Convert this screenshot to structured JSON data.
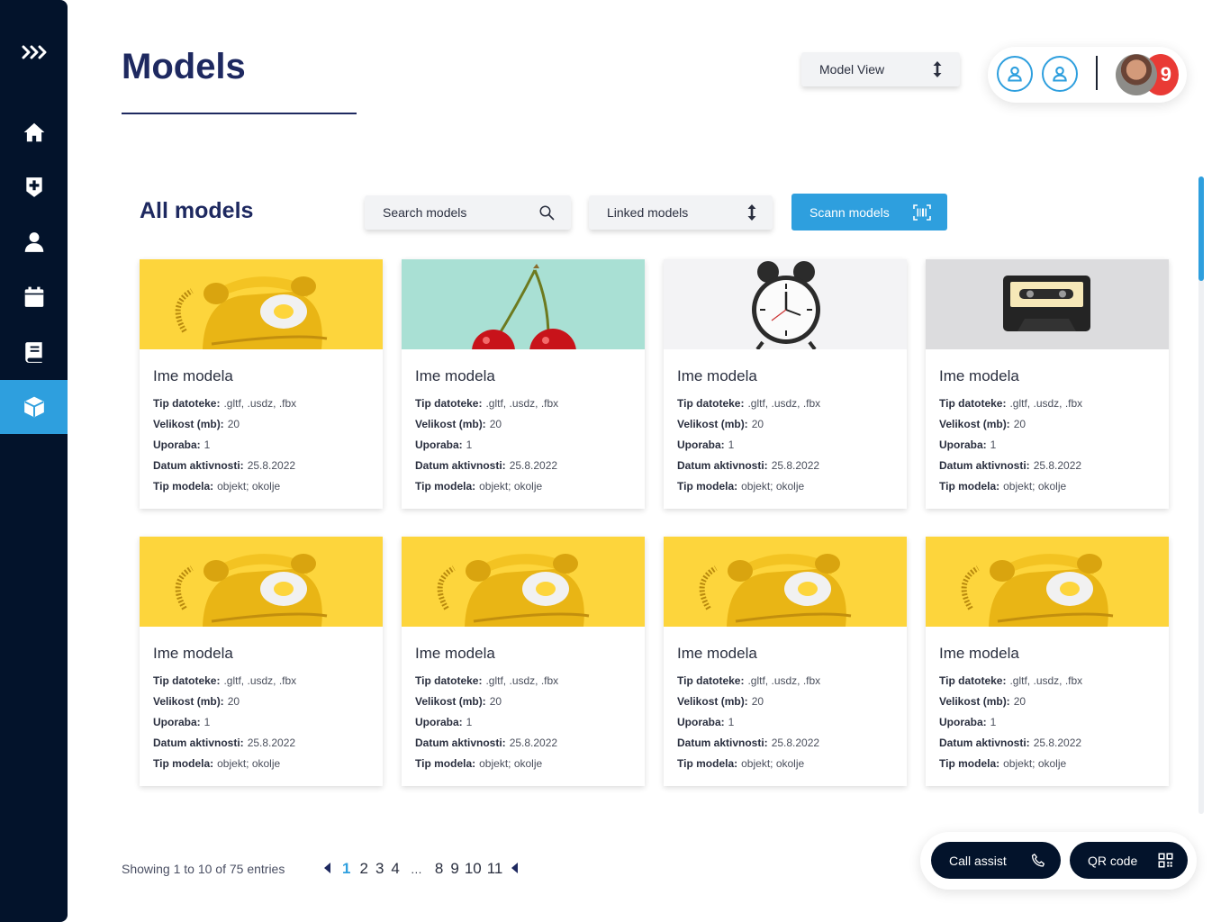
{
  "header": {
    "title": "Models",
    "view_select": "Model View"
  },
  "user": {
    "notification_count": "9"
  },
  "toolbar": {
    "section_title": "All models",
    "search_placeholder": "Search models",
    "filter_label": "Linked models",
    "scan_label": "Scann models"
  },
  "labels": {
    "file_type": "Tip datoteke:",
    "size": "Velikost (mb):",
    "usage": "Uporaba:",
    "activity_date": "Datum aktivnosti:",
    "model_type": "Tip modela:"
  },
  "cards": [
    {
      "image": "yellow-telephone",
      "name": "Ime modela",
      "file_type": ".gltf, .usdz, .fbx",
      "size": "20",
      "usage": "1",
      "activity_date": "25.8.2022",
      "model_type": "objekt; okolje"
    },
    {
      "image": "cherries",
      "name": "Ime modela",
      "file_type": ".gltf, .usdz, .fbx",
      "size": "20",
      "usage": "1",
      "activity_date": "25.8.2022",
      "model_type": "objekt; okolje"
    },
    {
      "image": "alarm-clock",
      "name": "Ime modela",
      "file_type": ".gltf, .usdz, .fbx",
      "size": "20",
      "usage": "1",
      "activity_date": "25.8.2022",
      "model_type": "objekt; okolje"
    },
    {
      "image": "cassette-tape",
      "name": "Ime modela",
      "file_type": ".gltf, .usdz, .fbx",
      "size": "20",
      "usage": "1",
      "activity_date": "25.8.2022",
      "model_type": "objekt; okolje"
    },
    {
      "image": "yellow-telephone",
      "name": "Ime modela",
      "file_type": ".gltf, .usdz, .fbx",
      "size": "20",
      "usage": "1",
      "activity_date": "25.8.2022",
      "model_type": "objekt; okolje"
    },
    {
      "image": "yellow-telephone",
      "name": "Ime modela",
      "file_type": ".gltf, .usdz, .fbx",
      "size": "20",
      "usage": "1",
      "activity_date": "25.8.2022",
      "model_type": "objekt; okolje"
    },
    {
      "image": "yellow-telephone",
      "name": "Ime modela",
      "file_type": ".gltf, .usdz, .fbx",
      "size": "20",
      "usage": "1",
      "activity_date": "25.8.2022",
      "model_type": "objekt; okolje"
    },
    {
      "image": "yellow-telephone",
      "name": "Ime modela",
      "file_type": ".gltf, .usdz, .fbx",
      "size": "20",
      "usage": "1",
      "activity_date": "25.8.2022",
      "model_type": "objekt; okolje"
    }
  ],
  "pagination": {
    "showing": "Showing 1 to 10 of 75 entries",
    "pages": [
      "1",
      "2",
      "3",
      "4",
      "…",
      "8",
      "9",
      "10",
      "11"
    ],
    "current": "1"
  },
  "actions": {
    "call_assist": "Call assist",
    "qr_code": "QR code"
  },
  "colors": {
    "sidebar": "#03132b",
    "accent": "#2e9fde",
    "title": "#1e2960",
    "notification": "#e93a35"
  },
  "sidebar_icons": [
    "chevrons-right-icon",
    "home-icon",
    "medical-plus-icon",
    "user-icon",
    "calendar-icon",
    "book-icon",
    "cube-icon"
  ]
}
